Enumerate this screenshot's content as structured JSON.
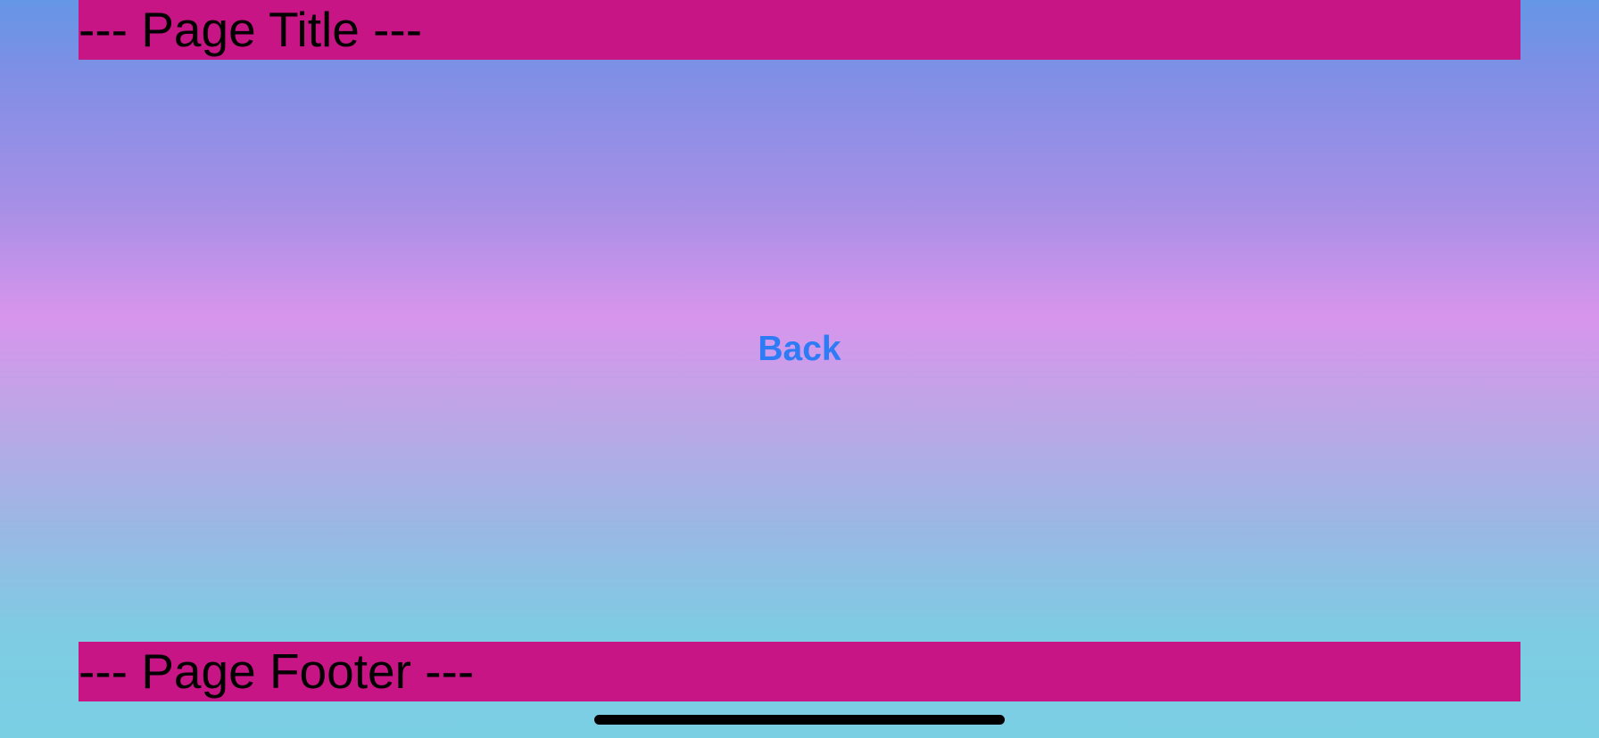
{
  "header": {
    "title": "--- Page Title ---"
  },
  "main": {
    "back_label": "Back"
  },
  "footer": {
    "text": "--- Page Footer ---"
  },
  "colors": {
    "bar_background": "#c71585",
    "link_accent": "#2e7bf6",
    "gradient_top": "#6596e6",
    "gradient_middle": "#d895ec",
    "gradient_bottom": "#7acfe3"
  }
}
